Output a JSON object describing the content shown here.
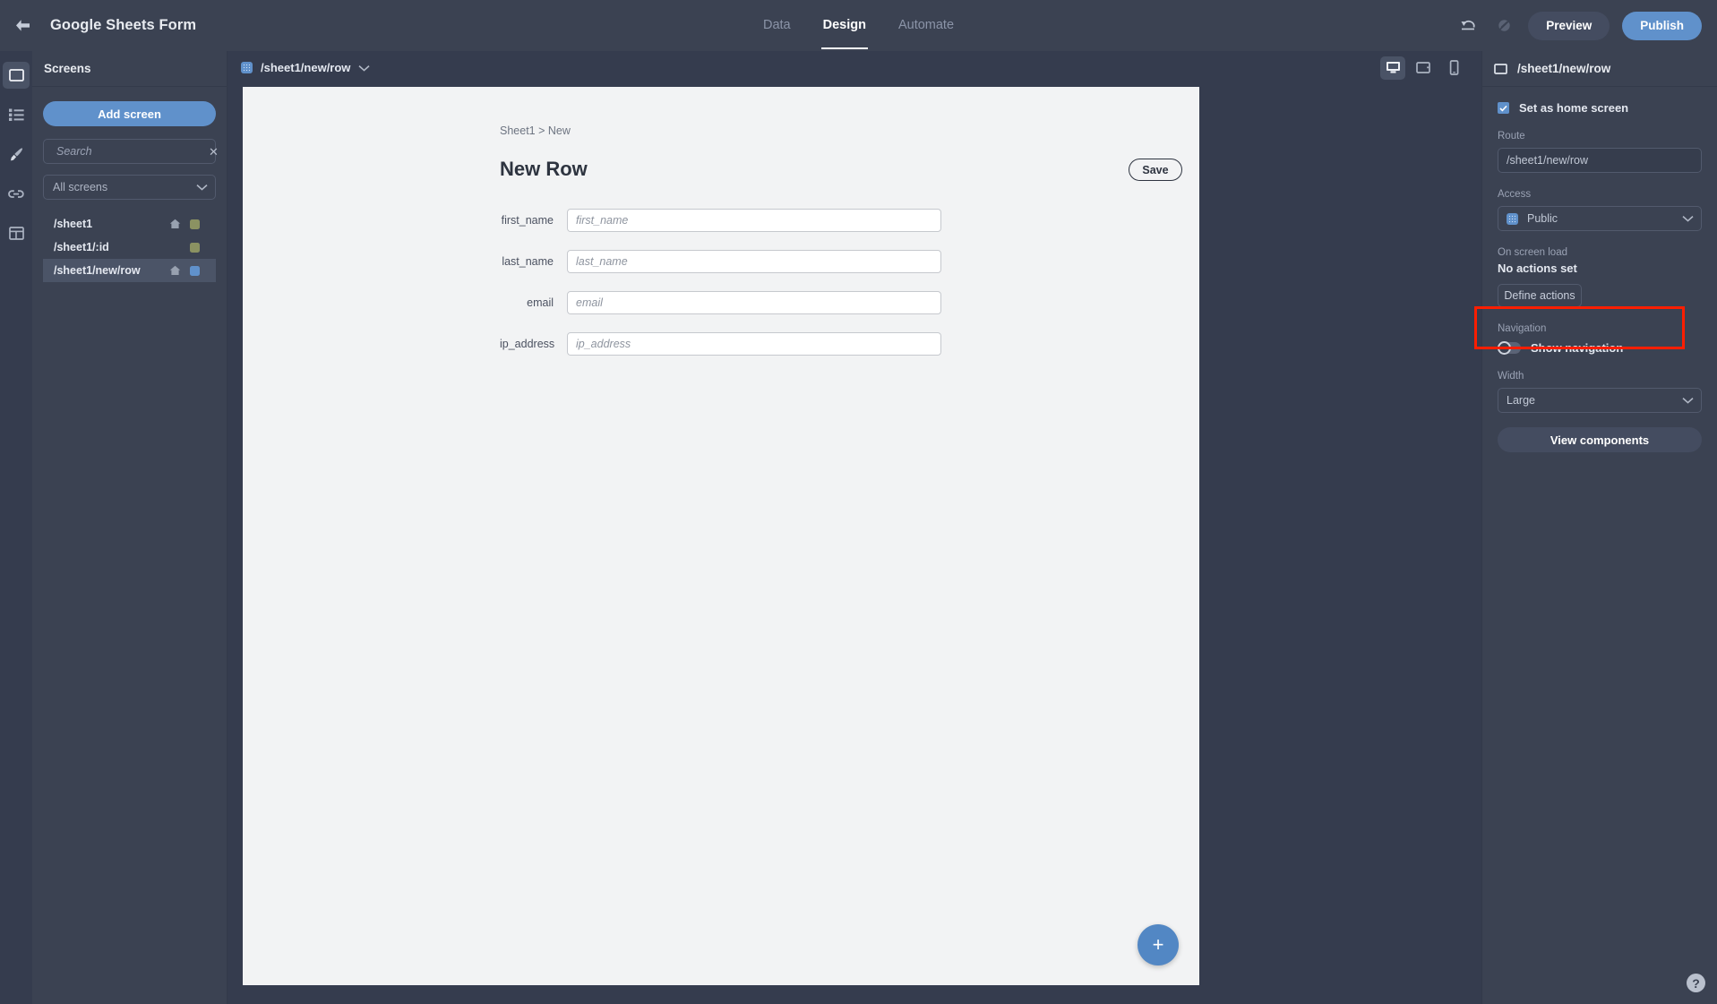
{
  "header": {
    "back_icon": "arrow-left-icon",
    "app_title": "Google Sheets Form",
    "tabs": [
      {
        "label": "Data",
        "active": false
      },
      {
        "label": "Design",
        "active": true
      },
      {
        "label": "Automate",
        "active": false
      }
    ],
    "undo_icon": "undo-icon",
    "redo_disabled_icon": "redo-disabled-icon",
    "preview_label": "Preview",
    "publish_label": "Publish"
  },
  "rail": {
    "items": [
      {
        "icon": "screen-icon",
        "active": true
      },
      {
        "icon": "list-icon",
        "active": false
      },
      {
        "icon": "brush-icon",
        "active": false
      },
      {
        "icon": "link-icon",
        "active": false
      },
      {
        "icon": "table-icon",
        "active": false
      }
    ]
  },
  "screens_panel": {
    "title": "Screens",
    "add_screen_label": "Add screen",
    "search": {
      "icon": "search-icon",
      "value": "",
      "placeholder": "Search",
      "clear_icon": "close-icon"
    },
    "filter": {
      "value": "All screens",
      "chevron_icon": "chevron-down-icon"
    },
    "items": [
      {
        "label": "/sheet1",
        "home": true,
        "badge_color": "#8b9262",
        "selected": false
      },
      {
        "label": "/sheet1/:id",
        "home": false,
        "badge_color": "#8b9262",
        "selected": false
      },
      {
        "label": "/sheet1/new/row",
        "home": true,
        "badge_color": "#6091cb",
        "selected": true
      }
    ]
  },
  "canvas": {
    "route_chip": {
      "icon": "dotted-square-icon",
      "label": "/sheet1/new/row",
      "chevron_icon": "chevron-down-icon"
    },
    "devices": [
      {
        "name": "desktop-icon",
        "active": true
      },
      {
        "name": "tablet-icon",
        "active": false
      },
      {
        "name": "mobile-icon",
        "active": false
      }
    ],
    "preview": {
      "breadcrumb": "Sheet1 > New",
      "title": "New Row",
      "save_label": "Save",
      "fields": [
        {
          "label": "first_name",
          "value": "",
          "placeholder": "first_name"
        },
        {
          "label": "last_name",
          "value": "",
          "placeholder": "last_name"
        },
        {
          "label": "email",
          "value": "",
          "placeholder": "email"
        },
        {
          "label": "ip_address",
          "value": "",
          "placeholder": "ip_address"
        }
      ],
      "fab_icon": "plus-icon",
      "fab_label": "+"
    }
  },
  "right_panel": {
    "head": {
      "icon": "screen-icon",
      "title": "/sheet1/new/row"
    },
    "home_checkbox": {
      "label": "Set as home screen",
      "checked": true
    },
    "route": {
      "label": "Route",
      "value": "/sheet1/new/row"
    },
    "access": {
      "label": "Access",
      "value": "Public",
      "icon": "dotted-square-icon",
      "chevron_icon": "chevron-down-icon"
    },
    "on_screen_load": {
      "label": "On screen load",
      "status": "No actions set",
      "button": "Define actions"
    },
    "navigation": {
      "label": "Navigation",
      "toggle_label": "Show navigation",
      "enabled": false,
      "highlight_color": "#ff1e00"
    },
    "width": {
      "label": "Width",
      "value": "Large",
      "chevron_icon": "chevron-down-icon"
    },
    "view_components_label": "View components",
    "help_icon": "help-icon",
    "help_label": "?"
  },
  "colors": {
    "accent": "#6091cb",
    "topbar_bg": "#3b4252",
    "panel_bg": "#3b4252",
    "canvas_bg": "#353c4e",
    "preview_bg": "#f2f3f4",
    "highlight": "#ff1e00",
    "badge_olive": "#8b9262"
  }
}
